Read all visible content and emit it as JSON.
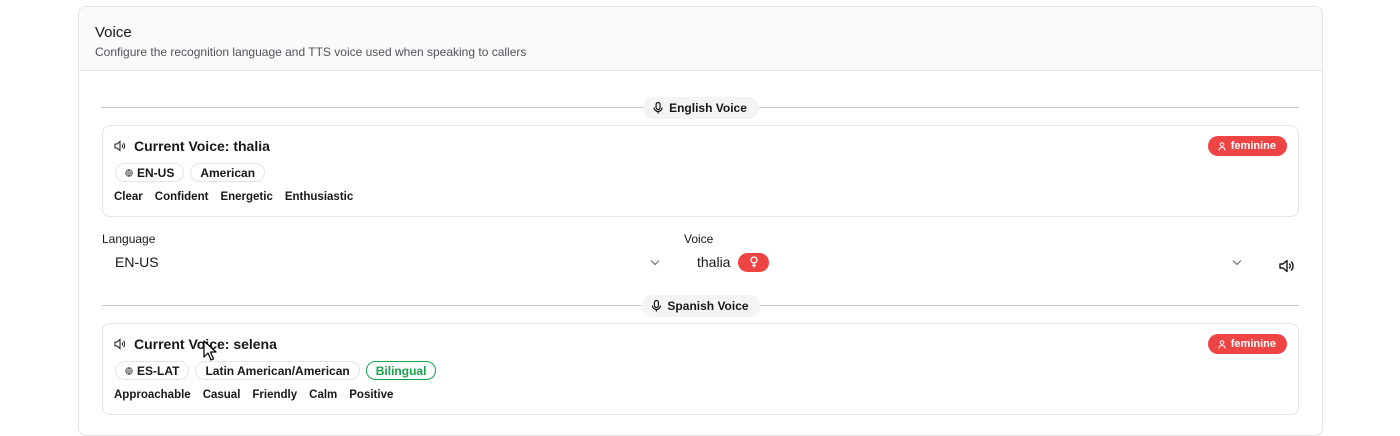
{
  "header": {
    "title": "Voice",
    "description": "Configure the recognition language and TTS voice used when speaking to callers"
  },
  "english": {
    "section_label": "English Voice",
    "current_voice_label": "Current Voice: thalia",
    "gender_badge": "feminine",
    "tags": [
      {
        "label": "EN-US",
        "icon": "globe-icon"
      },
      {
        "label": "American"
      }
    ],
    "traits": [
      "Clear",
      "Confident",
      "Energetic",
      "Enthusiastic"
    ]
  },
  "selectors": {
    "language_label": "Language",
    "language_value": "EN-US",
    "voice_label": "Voice",
    "voice_value": "thalia",
    "voice_gender_icon": "female-symbol-icon"
  },
  "spanish": {
    "section_label": "Spanish Voice",
    "current_voice_label": "Current Voice: selena",
    "gender_badge": "feminine",
    "tags": [
      {
        "label": "ES-LAT",
        "icon": "globe-icon"
      },
      {
        "label": "Latin American/American"
      },
      {
        "label": "Bilingual",
        "style": "green"
      }
    ],
    "traits": [
      "Approachable",
      "Casual",
      "Friendly",
      "Calm",
      "Positive"
    ]
  },
  "colors": {
    "accent_red": "#ef4444",
    "bilingual_green": "#16a34a",
    "border": "#e4e4e7"
  }
}
